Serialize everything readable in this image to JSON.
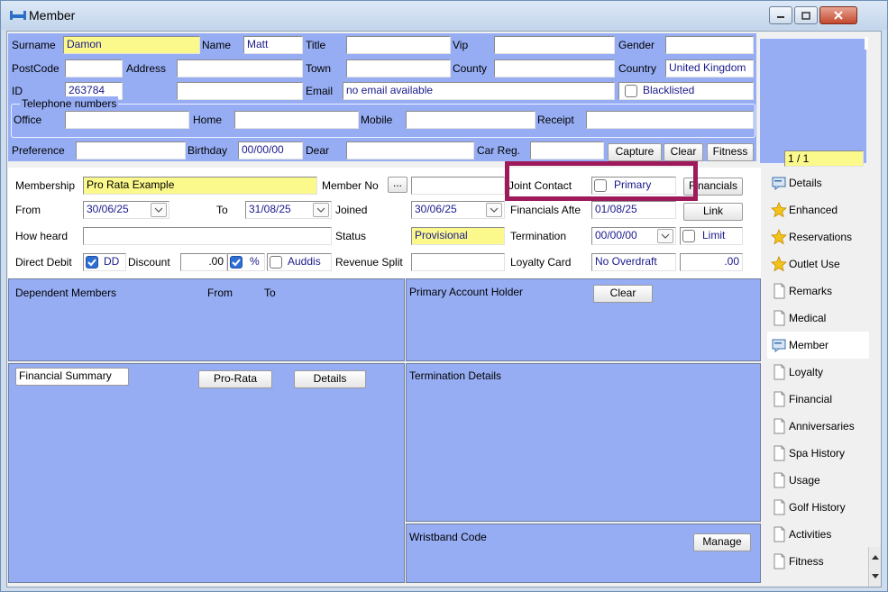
{
  "window": {
    "title": "Member"
  },
  "top_form": {
    "surname_label": "Surname",
    "surname": "Damon",
    "name_label": "Name",
    "name": "Matt",
    "title_label": "Title",
    "title": "",
    "vip_label": "Vip",
    "vip": "",
    "gender_label": "Gender",
    "gender": "",
    "postcode_label": "PostCode",
    "postcode": "",
    "address_label": "Address",
    "address": "",
    "town_label": "Town",
    "town": "",
    "county_label": "County",
    "county": "",
    "country_label": "Country",
    "country": "United Kingdom",
    "id_label": "ID",
    "id": "263784",
    "address2": "",
    "email_label": "Email",
    "email": "no email available",
    "blacklisted_label": "Blacklisted",
    "telephone_group": "Telephone numbers",
    "office_label": "Office",
    "home_label": "Home",
    "mobile_label": "Mobile",
    "receipt_label": "Receipt",
    "preference_label": "Preference",
    "birthday_label": "Birthday",
    "birthday": "00/00/00",
    "dear_label": "Dear",
    "car_reg_label": "Car Reg.",
    "capture_label": "Capture",
    "clear_label": "Clear",
    "fitness_label": "Fitness",
    "photo_counter": "1 / 1"
  },
  "membership": {
    "membership_label": "Membership",
    "membership": "Pro Rata Example",
    "member_no_label": "Member No",
    "ellipsis": "...",
    "joint_contact_label": "Joint Contact",
    "primary_label": "Primary",
    "financials_button": "Financials",
    "from_label": "From",
    "from": "30/06/25",
    "to_label": "To",
    "to": "31/08/25",
    "joined_label": "Joined",
    "joined": "30/06/25",
    "financials_after_label": "Financials Afte",
    "financials_after": "01/08/25",
    "link_button": "Link",
    "how_heard_label": "How heard",
    "status_label": "Status",
    "status": "Provisional",
    "termination_label": "Termination",
    "termination": "00/00/00",
    "limit_label": "Limit",
    "direct_debit_label": "Direct Debit",
    "dd_label": "DD",
    "discount_label": "Discount",
    "discount": ".00",
    "percent_label": "%",
    "auddis_label": "Auddis",
    "revenue_split_label": "Revenue Split",
    "loyalty_card_label": "Loyalty Card",
    "loyalty_card": "No Overdraft",
    "loyalty_value": ".00"
  },
  "panels": {
    "dependent_members": "Dependent Members",
    "dep_from": "From",
    "dep_to": "To",
    "primary_account_holder": "Primary Account Holder",
    "pah_clear": "Clear",
    "financial_summary": "Financial Summary",
    "pro_rata": "Pro-Rata",
    "details": "Details",
    "termination_details": "Termination Details",
    "wristband_code": "Wristband Code",
    "manage": "Manage"
  },
  "sidebar": {
    "items": [
      {
        "label": "Details",
        "icon": "chat-icon"
      },
      {
        "label": "Enhanced",
        "icon": "star-icon"
      },
      {
        "label": "Reservations",
        "icon": "star-icon"
      },
      {
        "label": "Outlet Use",
        "icon": "star-icon"
      },
      {
        "label": "Remarks",
        "icon": "page-icon"
      },
      {
        "label": "Medical",
        "icon": "page-icon"
      },
      {
        "label": "Member",
        "icon": "chat-icon"
      },
      {
        "label": "Loyalty",
        "icon": "page-icon"
      },
      {
        "label": "Financial",
        "icon": "page-icon"
      },
      {
        "label": "Anniversaries",
        "icon": "page-icon"
      },
      {
        "label": "Spa History",
        "icon": "page-icon"
      },
      {
        "label": "Usage",
        "icon": "page-icon"
      },
      {
        "label": "Golf History",
        "icon": "page-icon"
      },
      {
        "label": "Activities",
        "icon": "page-icon"
      },
      {
        "label": "Fitness",
        "icon": "page-icon"
      }
    ]
  },
  "colors": {
    "panel_blue": "#96adf4",
    "field_yellow": "#fbf98c",
    "highlight": "#9e1a5a",
    "value_text": "#1a1a8c"
  }
}
